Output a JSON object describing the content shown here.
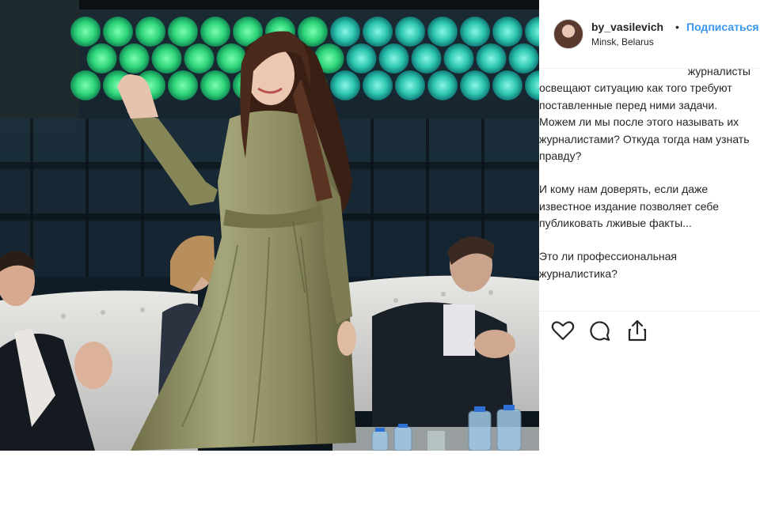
{
  "post": {
    "username": "by_vasilevich",
    "separator": "•",
    "follow_label": "Подписаться",
    "location": "Minsk, Belarus"
  },
  "caption": {
    "partial_top": "журналисты",
    "paragraph_1": "освещают ситуацию как того требуют поставленные перед ними задачи. Можем ли мы после этого называть их журналистами? Откуда тогда нам узнать правду?",
    "paragraph_2": "И кому нам доверять, если даже известное издание позволяет себе публиковать лживые факты...",
    "paragraph_3": "Это ли профессиональная журналистика?"
  },
  "actions": {
    "like_icon": "heart-icon",
    "comment_icon": "comment-icon",
    "share_icon": "share-icon"
  },
  "colors": {
    "accent": "#3897f0",
    "text": "#262626",
    "divider": "#efefef",
    "photo_glow": "#3be07a",
    "dress": "#8a8a5c"
  }
}
